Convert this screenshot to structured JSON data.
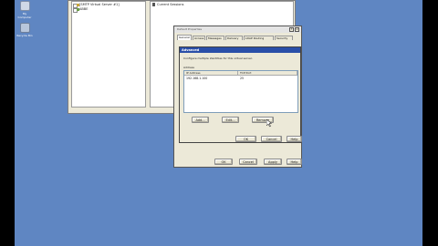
{
  "desktop": {
    "icons": [
      {
        "label": "My Computer"
      },
      {
        "label": "Recycle Bin"
      }
    ]
  },
  "mmc": {
    "tree": [
      {
        "label": "[SMTP Virtual Server #1]"
      },
      {
        "label": "ABBE"
      }
    ],
    "right_pane": {
      "item": "Current Sessions"
    }
  },
  "properties_dialog": {
    "title": "Default Properties",
    "tabs": [
      "General",
      "Access",
      "Messages",
      "Delivery",
      "LDAP Routing",
      "Security"
    ],
    "ok_label": "OK",
    "cancel_label": "Cancel",
    "apply_label": "Apply",
    "help_label": "Help"
  },
  "advanced_dialog": {
    "title": "Advanced",
    "description": "Configure multiple identities for this virtual server.",
    "group_label": "Address",
    "columns": [
      "IP Address",
      "TCP Port"
    ],
    "rows": [
      {
        "ip": "192.168.1.100",
        "port": "25"
      }
    ],
    "add_label": "Add...",
    "edit_label": "Edit...",
    "remove_label": "Remove",
    "ok_label": "OK",
    "cancel_label": "Cancel",
    "help_label": "Help"
  }
}
